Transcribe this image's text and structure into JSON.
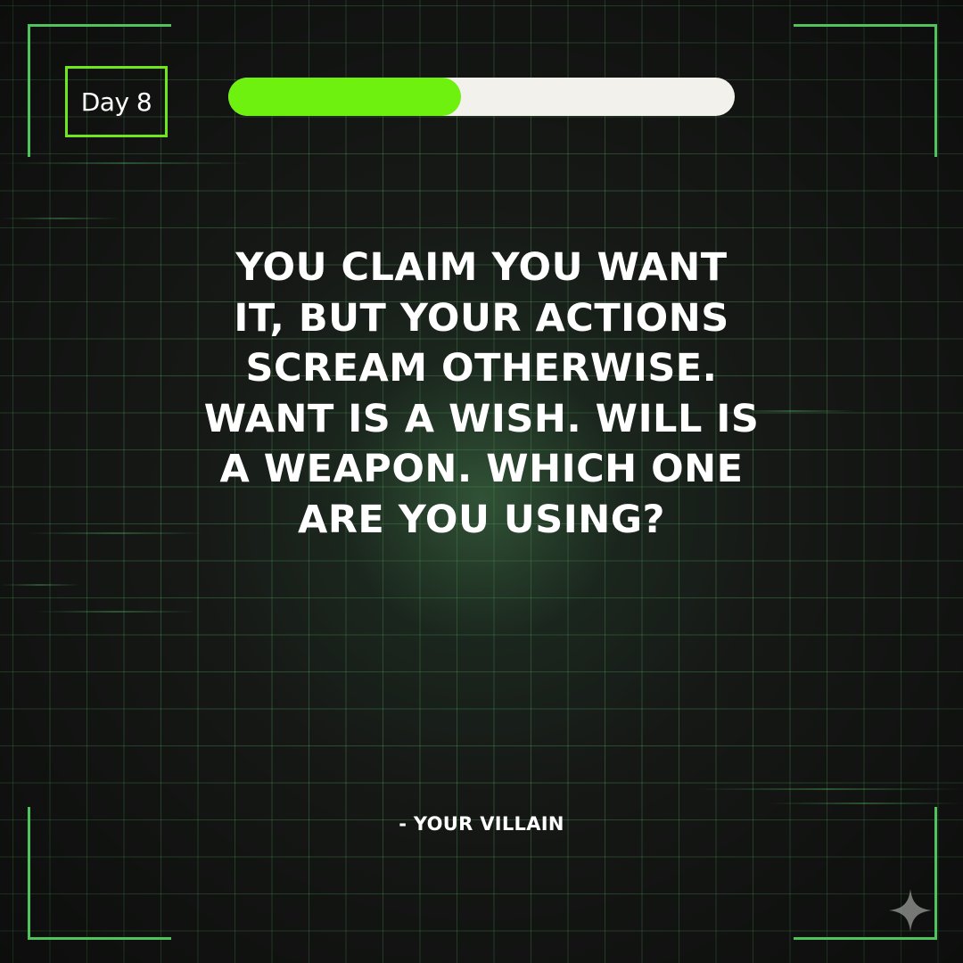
{
  "badge": {
    "label": "Day 8"
  },
  "progress": {
    "fraction": 0.46
  },
  "quote": {
    "lines": [
      "YOU CLAIM YOU WANT",
      "IT, BUT YOUR ACTIONS",
      "SCREAM OTHERWISE.",
      "WANT IS A WISH. WILL IS",
      "A WEAPON. WHICH ONE",
      "ARE YOU USING?"
    ]
  },
  "attribution": "- YOUR VILLAIN",
  "colors": {
    "accent": "#6ff10f",
    "frame": "#4fc45c",
    "track": "#f3f1ec",
    "background": "#161816"
  },
  "icons": {
    "corner_mark": "sparkle-icon"
  }
}
